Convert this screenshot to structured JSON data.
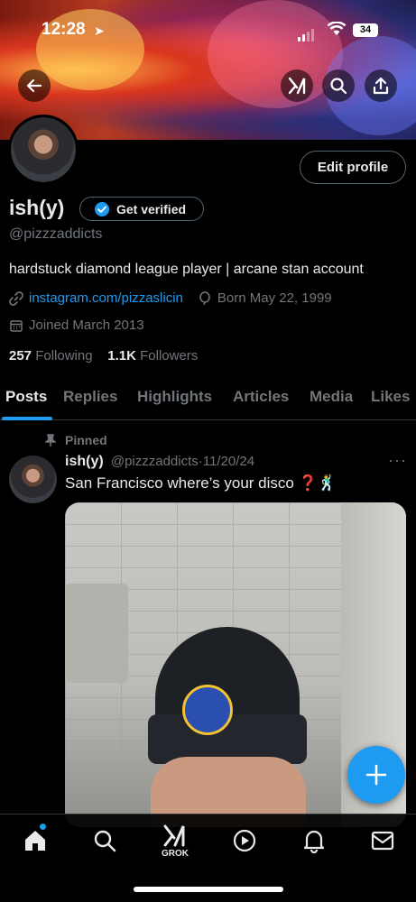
{
  "status_bar": {
    "time": "12:28",
    "battery": "34"
  },
  "profile": {
    "name": "ish(y)",
    "verify_label": "Get verified",
    "handle": "@pizzzaddicts",
    "bio": "hardstuck diamond league player | arcane stan account",
    "link": "instagram.com/pizzaslicin",
    "birthday": "Born May 22, 1999",
    "joined": "Joined March 2013",
    "following_count": "257",
    "following_label": "Following",
    "followers_count": "1.1K",
    "followers_label": "Followers",
    "edit_label": "Edit profile"
  },
  "tabs": [
    {
      "label": "Posts"
    },
    {
      "label": "Replies"
    },
    {
      "label": "Highlights"
    },
    {
      "label": "Articles"
    },
    {
      "label": "Media"
    },
    {
      "label": "Likes"
    }
  ],
  "post": {
    "pinned_label": "Pinned",
    "author": "ish(y)",
    "handle": "@pizzzaddicts",
    "separator": "·",
    "date": "11/20/24",
    "text": "San Francisco where’s your disco ❓🕺",
    "more": "···"
  },
  "bottom_nav": {
    "grok_label": "GROK"
  },
  "colors": {
    "accent": "#1d9bf0",
    "background": "#000000",
    "muted": "#71767b",
    "text": "#e7e9ea"
  },
  "icons": [
    "back-arrow-icon",
    "grok-icon",
    "search-icon",
    "share-icon",
    "verified-badge-icon",
    "link-icon",
    "balloon-icon",
    "calendar-icon",
    "pin-icon",
    "plus-icon",
    "home-icon",
    "play-icon",
    "bell-icon",
    "mail-icon"
  ]
}
